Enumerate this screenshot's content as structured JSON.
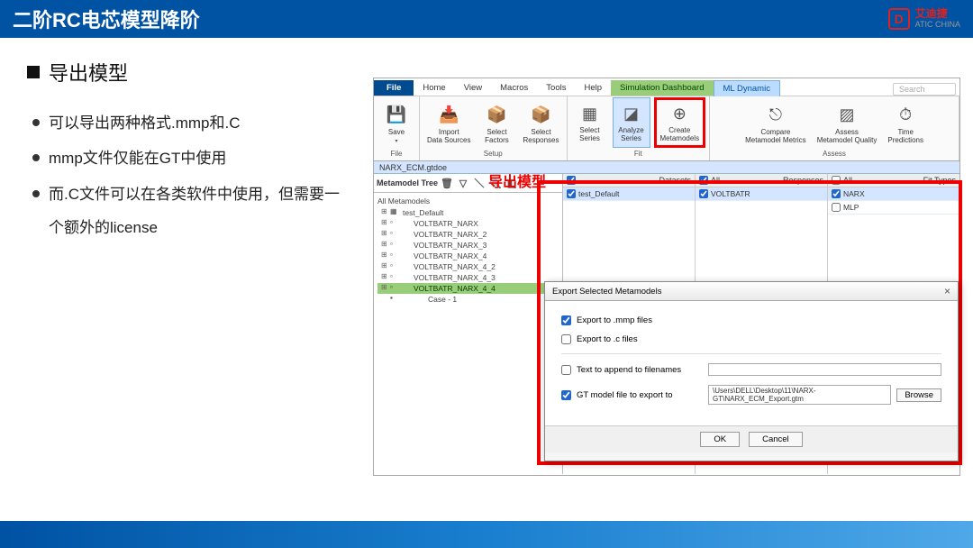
{
  "slide": {
    "title": "二阶RC电芯模型降阶",
    "logo_main": "艾迪捷",
    "logo_sub": "ATIC CHINA",
    "bullet_h": "导出模型",
    "bullets": [
      "可以导出两种格式.mmp和.C",
      "mmp文件仅能在GT中使用",
      "而.C文件可以在各类软件中使用，但需要一个额外的license"
    ],
    "annot": "导出模型"
  },
  "app": {
    "menus": {
      "file": "File",
      "home": "Home",
      "view": "View",
      "macros": "Macros",
      "tools": "Tools",
      "help": "Help",
      "sim": "Simulation Dashboard",
      "ml": "ML Dynamic"
    },
    "search_ph": "Search",
    "ribbon": {
      "save": "Save",
      "file_grp": "File",
      "import": "Import\nData Sources",
      "factors": "Select\nFactors",
      "responses": "Select\nResponses",
      "setup_grp": "Setup",
      "sel_series": "Select\nSeries",
      "analyze": "Analyze\nSeries",
      "create": "Create\nMetamodels",
      "fit_grp": "Fit",
      "compare": "Compare\nMetamodel Metrics",
      "quality": "Assess\nMetamodel Quality",
      "time": "Time\nPredictions",
      "assess_grp": "Assess"
    },
    "filepath": "NARX_ECM.gtdoe",
    "tree": {
      "header": "Metamodel Tree",
      "root": "All Metamodels",
      "parent": "test_Default",
      "items": [
        "VOLTBATR_NARX",
        "VOLTBATR_NARX_2",
        "VOLTBATR_NARX_3",
        "VOLTBATR_NARX_4",
        "VOLTBATR_NARX_4_2",
        "VOLTBATR_NARX_4_3",
        "VOLTBATR_NARX_4_4"
      ],
      "sel_index": 6,
      "case": "Case - 1"
    },
    "cols": {
      "datasets": {
        "hdr_all": "",
        "hdr": "Datasets",
        "items": [
          "test_Default"
        ]
      },
      "responses": {
        "hdr_all": "All",
        "hdr": "Responses",
        "items": [
          "VOLTBATR"
        ]
      },
      "fittypes": {
        "hdr_all": "All",
        "hdr": "Fit Types",
        "items": [
          "NARX",
          "MLP"
        ]
      }
    }
  },
  "dialog": {
    "title": "Export Selected Metamodels",
    "opt_mmp": "Export to .mmp files",
    "opt_c": "Export to .c files",
    "append_lbl": "Text to append to filenames",
    "gtmodel_lbl": "GT model file to export to",
    "gtmodel_path": "\\Users\\DELL\\Desktop\\11\\NARX-GT\\NARX_ECM_Export.gtm",
    "browse": "Browse",
    "ok": "OK",
    "cancel": "Cancel"
  }
}
